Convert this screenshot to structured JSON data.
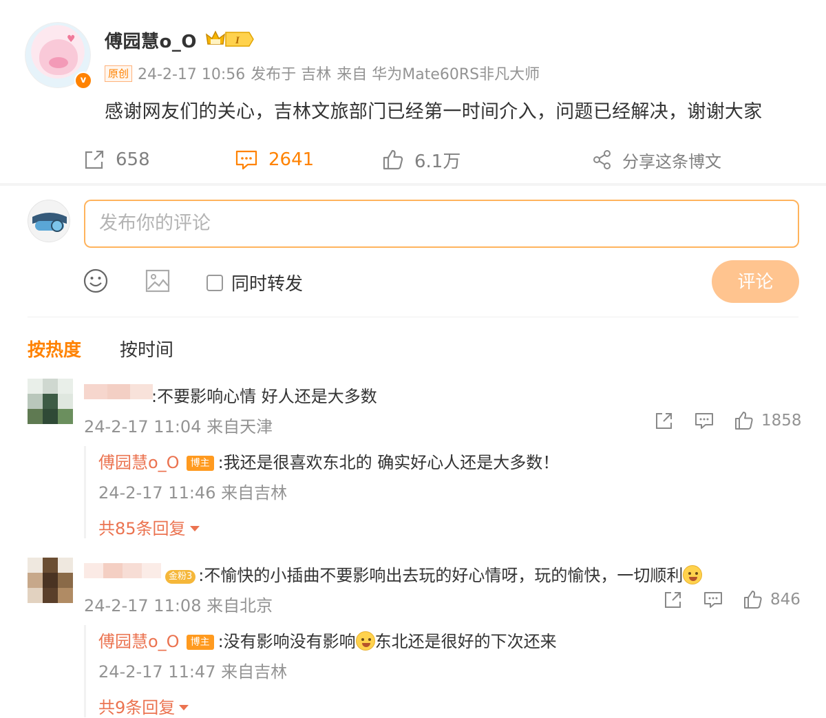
{
  "post": {
    "author": "傅园慧o_O",
    "original_tag": "原创",
    "timestamp": "24-2-17 10:56",
    "published_in": "发布于 吉林",
    "device": "来自 华为Mate60RS非凡大师",
    "text": "感谢网友们的关心，吉林文旅部门已经第一时间介入，问题已经解决，谢谢大家",
    "verify_badge": "v",
    "level_badge": "I",
    "actions": {
      "repost_count": "658",
      "comment_count": "2641",
      "like_count": "6.1万",
      "share_label": "分享这条博文"
    }
  },
  "composer": {
    "placeholder": "发布你的评论",
    "repost_label": "同时转发",
    "submit_label": "评论"
  },
  "sort_tabs": {
    "hot": "按热度",
    "time": "按时间"
  },
  "comments": [
    {
      "text": ":不要影响心情 好人还是大多数",
      "time": "24-2-17 11:04 来自天津",
      "likes": "1858",
      "reply": {
        "author": "傅园慧o_O",
        "tag": "博主",
        "text": ":我还是很喜欢东北的 确实好心人还是大多数！",
        "time": "24-2-17 11:46 来自吉林"
      },
      "more_replies": "共85条回复"
    },
    {
      "fan_badge": "金粉3",
      "text": ":不愉快的小插曲不要影响出去玩的好心情呀，玩的愉快，一切顺利",
      "time": "24-2-17 11:08 来自北京",
      "likes": "846",
      "reply": {
        "author": "傅园慧o_O",
        "tag": "博主",
        "text_before": ":没有影响没有影响",
        "text_after": "东北还是很好的下次还来",
        "time": "24-2-17 11:47 来自吉林"
      },
      "more_replies": "共9条回复"
    }
  ],
  "colors": {
    "accent": "#ff8200",
    "reply_name": "#eb7350",
    "muted": "#939393",
    "submit_disabled": "#ffc48f"
  }
}
